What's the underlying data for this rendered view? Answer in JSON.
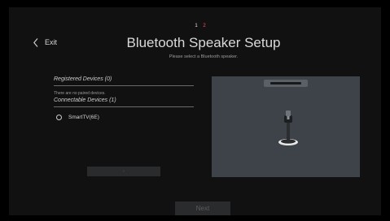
{
  "steps": [
    "1",
    "2"
  ],
  "header": {
    "exit_label": "Exit",
    "title": "Bluetooth Speaker Setup",
    "subtitle": "Please select a Bluetooth speaker."
  },
  "registered": {
    "heading": "Registered Devices (0)",
    "empty_note": "There are no paired devices."
  },
  "connectable": {
    "heading": "Connectable Devices (1)",
    "devices": [
      {
        "label": "SmartTV(6E)",
        "selected": false
      }
    ]
  },
  "secondary_button_label": "›",
  "next_label": "Next",
  "icons": {
    "exit": "chevron-left-icon",
    "radio": "radio-unchecked-icon"
  },
  "colors": {
    "screen_bg": "#111112",
    "preview_bg": "#3d4349",
    "step_inactive": "#ff4f5f"
  }
}
